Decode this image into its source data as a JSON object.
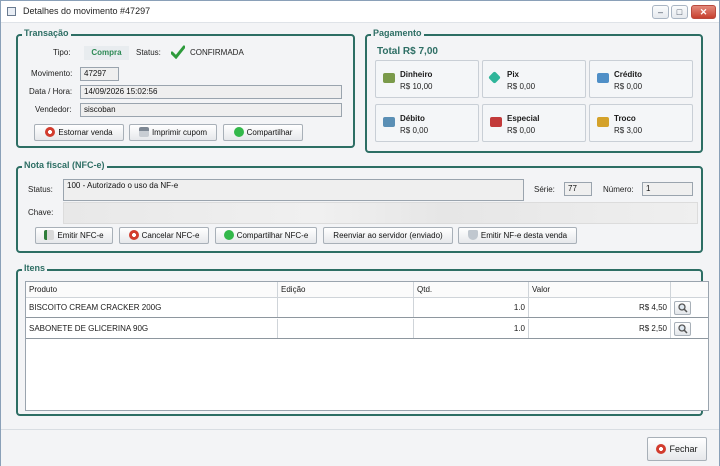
{
  "window": {
    "title": "Detalhes do movimento #47297"
  },
  "transacao": {
    "legend": "Transação",
    "tipo_label": "Tipo:",
    "tipo_value": "Compra",
    "status_label": "Status:",
    "status_value": "CONFIRMADA",
    "movimento_label": "Movimento:",
    "movimento_value": "47297",
    "datahora_label": "Data / Hora:",
    "datahora_value": "14/09/2026  15:02:56",
    "vendedor_label": "Vendedor:",
    "vendedor_value": "siscoban",
    "buttons": {
      "estornar": "Estornar venda",
      "imprimir": "Imprimir cupom",
      "compartilhar": "Compartilhar"
    }
  },
  "pagamento": {
    "legend": "Pagamento",
    "total": "Total  R$ 7,00",
    "cards": [
      {
        "name": "Dinheiro",
        "value": "R$ 10,00",
        "color": "#7a9a4a"
      },
      {
        "name": "Pix",
        "value": "R$ 0,00",
        "color": "#2fb59a"
      },
      {
        "name": "Crédito",
        "value": "R$ 0,00",
        "color": "#4f8fc7"
      },
      {
        "name": "Débito",
        "value": "R$ 0,00",
        "color": "#5a8fb5"
      },
      {
        "name": "Especial",
        "value": "R$ 0,00",
        "color": "#c23a3a"
      },
      {
        "name": "Troco",
        "value": "R$ 3,00",
        "color": "#d4a22a"
      }
    ]
  },
  "nfce": {
    "legend": "Nota fiscal (NFC-e)",
    "status_label": "Status:",
    "status_value": "100 - Autorizado o uso da NF-e",
    "serie_label": "Série:",
    "serie_value": "77",
    "numero_label": "Número:",
    "numero_value": "1",
    "chave_label": "Chave:",
    "buttons": {
      "emitir": "Emitir NFC-e",
      "cancelar": "Cancelar NFC-e",
      "compartilhar": "Compartilhar NFC-e",
      "reenviar": "Reenviar ao servidor (enviado)",
      "emitir_nfe": "Emitir NF-e desta venda"
    }
  },
  "itens": {
    "legend": "Itens",
    "columns": [
      "Produto",
      "Edição",
      "Qtd.",
      "Valor"
    ],
    "rows": [
      {
        "produto": "BISCOITO CREAM CRACKER 200G",
        "edicao": "",
        "qtd": "1.0",
        "valor": "R$ 4,50"
      },
      {
        "produto": "SABONETE DE GLICERINA 90G",
        "edicao": "",
        "qtd": "1.0",
        "valor": "R$ 2,50"
      }
    ]
  },
  "footer": {
    "fechar": "Fechar"
  }
}
